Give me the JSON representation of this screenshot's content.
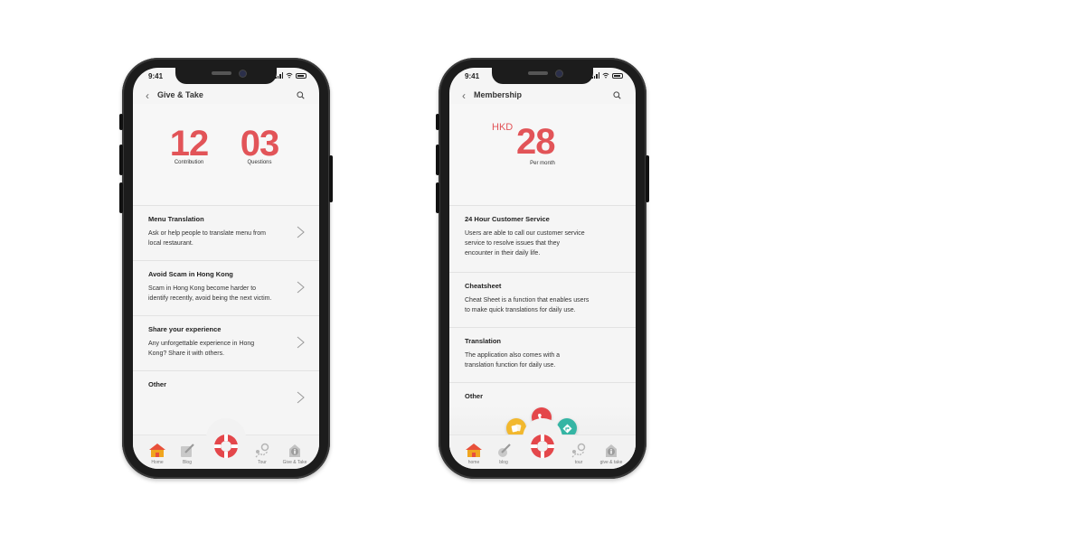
{
  "phone_left": {
    "status": {
      "time": "9:41"
    },
    "header": {
      "back_icon": "chevron-left-icon",
      "title": "Give & Take",
      "search_icon": "search-icon"
    },
    "stats": [
      {
        "value": "12",
        "label": "Contribution"
      },
      {
        "value": "03",
        "label": "Questions"
      }
    ],
    "items": [
      {
        "title": "Menu Translation",
        "desc1": "Ask or help people to translate menu from",
        "desc2": "local restaurant."
      },
      {
        "title": "Avoid Scam in Hong Kong",
        "desc1": "Scam in Hong Kong become harder to",
        "desc2": "identify recently, avoid being the next victim."
      },
      {
        "title": "Share your experience",
        "desc1": "Any unforgettable experience in Hong",
        "desc2": "Kong? Share it with others."
      },
      {
        "title": "Other"
      }
    ],
    "tabs": [
      {
        "label": "Home",
        "icon": "house-icon"
      },
      {
        "label": "Blog",
        "icon": "pen-icon"
      },
      {
        "label": "",
        "icon": "lifebuoy-icon"
      },
      {
        "label": "Tour",
        "icon": "map-pin-icon"
      },
      {
        "label": "Give & Take",
        "icon": "info-icon"
      }
    ]
  },
  "phone_right": {
    "status": {
      "time": "9:41"
    },
    "header": {
      "back_icon": "chevron-left-icon",
      "title": "Membership",
      "search_icon": "search-icon"
    },
    "price": {
      "currency": "HKD",
      "amount": "28",
      "period": "Per month"
    },
    "items": [
      {
        "title": "24 Hour Customer Service",
        "desc1": "Users are able to call our customer service",
        "desc2": "service to resolve issues that they",
        "desc3": "encounter in their daily life."
      },
      {
        "title": "Cheatsheet",
        "desc1": "Cheat Sheet is a function that enables users",
        "desc2": "to make quick translations for daily use."
      },
      {
        "title": "Translation",
        "desc1": "The application also comes with a",
        "desc2": "translation function for daily use."
      },
      {
        "title": "Other"
      }
    ],
    "quick_actions": [
      {
        "icon": "cards-icon",
        "color": "#f2b82e"
      },
      {
        "icon": "phone-icon",
        "color": "#e4474b"
      },
      {
        "icon": "direction-icon",
        "color": "#35b5a4"
      }
    ],
    "tabs": [
      {
        "label": "home",
        "icon": "house-icon"
      },
      {
        "label": "blog",
        "icon": "pen-icon"
      },
      {
        "label": "",
        "icon": "lifebuoy-icon"
      },
      {
        "label": "tour",
        "icon": "map-pin-icon"
      },
      {
        "label": "give & take",
        "icon": "info-icon"
      }
    ]
  },
  "colors": {
    "accent": "#e25458",
    "background": "#f5f5f5",
    "frame": "#1c1c1c",
    "home_icon": "#f0a51f"
  }
}
